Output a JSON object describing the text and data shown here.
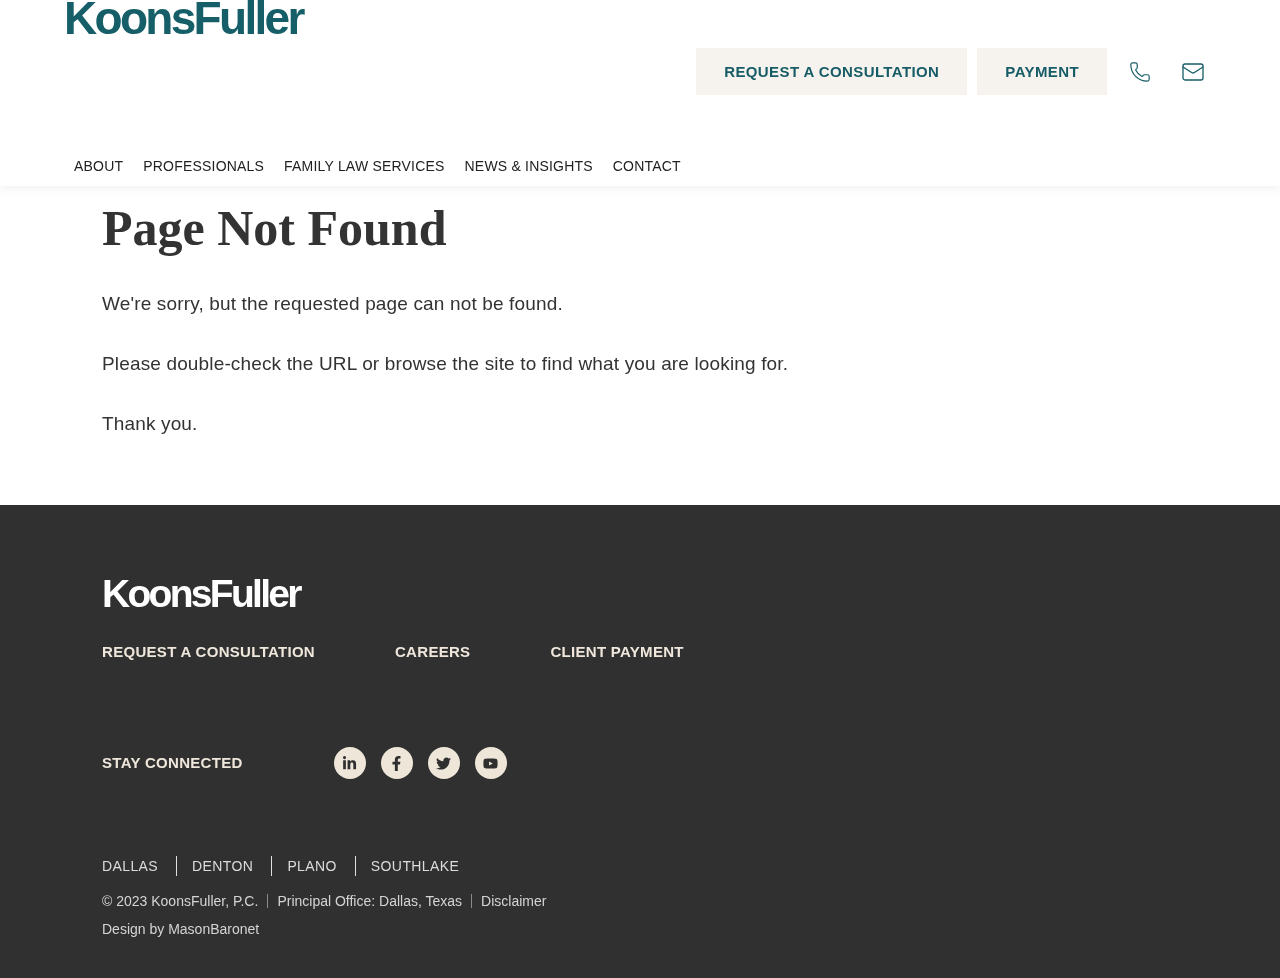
{
  "header": {
    "logo": "KoonsFuller",
    "buttons": [
      "REQUEST A CONSULTATION",
      "PAYMENT"
    ],
    "nav": [
      "ABOUT",
      "PROFESSIONALS",
      "FAMILY LAW SERVICES",
      "NEWS & INSIGHTS",
      "CONTACT"
    ]
  },
  "main": {
    "title": "Page Not Found",
    "paragraphs": [
      "We're sorry, but the requested page can not be found.",
      "Please double-check the URL or browse the site to find what you are looking for.",
      "Thank you."
    ]
  },
  "footer": {
    "logo": "KoonsFuller",
    "links": [
      "REQUEST A CONSULTATION",
      "CAREERS",
      "CLIENT PAYMENT"
    ],
    "social_label": "STAY CONNECTED",
    "locations": [
      "DALLAS",
      "DENTON",
      "PLANO",
      "SOUTHLAKE"
    ],
    "legal": {
      "copyright": "© 2023 KoonsFuller, P.C.",
      "office": "Principal Office: Dallas, Texas",
      "disclaimer": "Disclaimer"
    },
    "credit": "Design by MasonBaronet"
  }
}
